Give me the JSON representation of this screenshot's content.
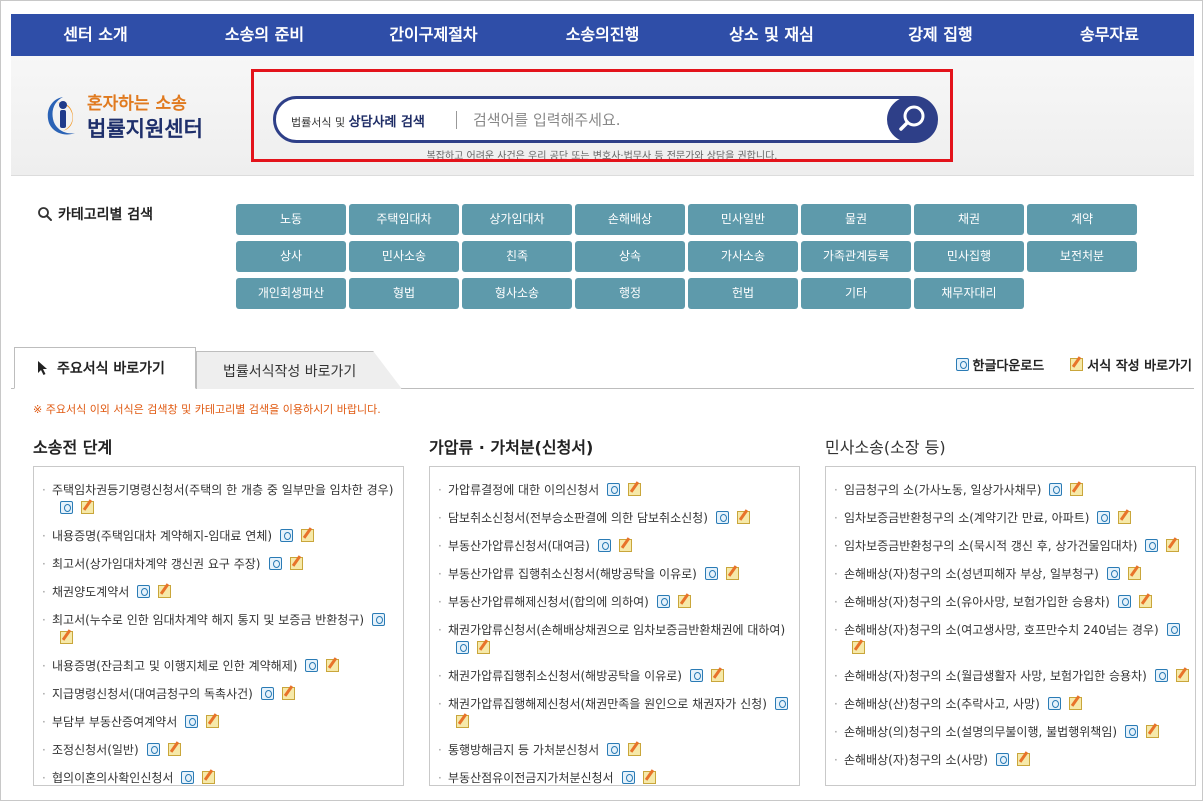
{
  "nav": [
    "센터 소개",
    "소송의 준비",
    "간이구제절차",
    "소송의진행",
    "상소 및 재심",
    "강제 집행",
    "송무자료"
  ],
  "logo": {
    "line1": "혼자하는 소송",
    "line2": "법률지원센터"
  },
  "search": {
    "label_small": "법률서식 및",
    "label_bold": "상담사례 검색",
    "placeholder": "검색어를 입력해주세요.",
    "notice": "복잡하고 어려운 사건은 우리 공단 또는 변호사·법무사 등 전문가와 상담을 권합니다."
  },
  "category": {
    "title": "카테고리별 검색",
    "items": [
      "노동",
      "주택임대차",
      "상가임대차",
      "손해배상",
      "민사일반",
      "물권",
      "채권",
      "계약",
      "상사",
      "민사소송",
      "친족",
      "상속",
      "가사소송",
      "가족관계등록",
      "민사집행",
      "보전처분",
      "개인회생파산",
      "형법",
      "형사소송",
      "행정",
      "헌법",
      "기타",
      "채무자대리"
    ]
  },
  "tabs": {
    "active": "주요서식 바로가기",
    "inactive": "법률서식작성 바로가기",
    "hwp_download": "한글다운로드",
    "form_write": "서식 작성 바로가기"
  },
  "notice": "※ 주요서식 이외 서식은 검색창 및 카테고리별 검색을 이용하시기 바랍니다.",
  "columns": [
    {
      "title": "소송전 단계",
      "items": [
        "주택임차권등기명령신청서(주택의 한 개층 중 일부만을 임차한 경우)",
        "내용증명(주택임대차 계약해지-임대료 연체)",
        "최고서(상가임대차계약 갱신권 요구 주장)",
        "채권양도계약서",
        "최고서(누수로 인한 임대차계약 해지 통지 및 보증금 반환청구)",
        "내용증명(잔금최고 및 이행지체로 인한 계약해제)",
        "지급명령신청서(대여금청구의 독촉사건)",
        "부담부 부동산증여계약서",
        "조정신청서(일반)",
        "협의이혼의사확인신청서"
      ]
    },
    {
      "title": "가압류 · 가처분(신청서)",
      "items": [
        "가압류결정에 대한 이의신청서",
        "담보취소신청서(전부승소판결에 의한 담보취소신청)",
        "부동산가압류신청서(대여금)",
        "부동산가압류 집행취소신청서(해방공탁을 이유로)",
        "부동산가압류해제신청서(합의에 의하여)",
        "채권가압류신청서(손해배상채권으로 임차보증금반환채권에 대하여)",
        "채권가압류집행취소신청서(해방공탁을 이유로)",
        "채권가압류집행해제신청서(채권만족을 원인으로 채권자가 신청)",
        "통행방해금지 등 가처분신청서",
        "부동산점유이전금지가처분신청서"
      ]
    },
    {
      "title": "민사소송(소장 등)",
      "items": [
        "임금청구의 소(가사노동, 일상가사채무)",
        "임차보증금반환청구의 소(계약기간 만료, 아파트)",
        "임차보증금반환청구의 소(묵시적 갱신 후, 상가건물임대차)",
        "손해배상(자)청구의 소(성년피해자 부상, 일부청구)",
        "손해배상(자)청구의 소(유아사망, 보험가입한 승용차)",
        "손해배상(자)청구의 소(여고생사망, 호프만수치 240넘는 경우)",
        "손해배상(자)청구의 소(월급생활자 사망, 보험가입한 승용차)",
        "손해배상(산)청구의 소(추락사고, 사망)",
        "손해배상(의)청구의 소(설명의무불이행, 불법행위책임)",
        "손해배상(자)청구의 소(사망)"
      ]
    }
  ]
}
